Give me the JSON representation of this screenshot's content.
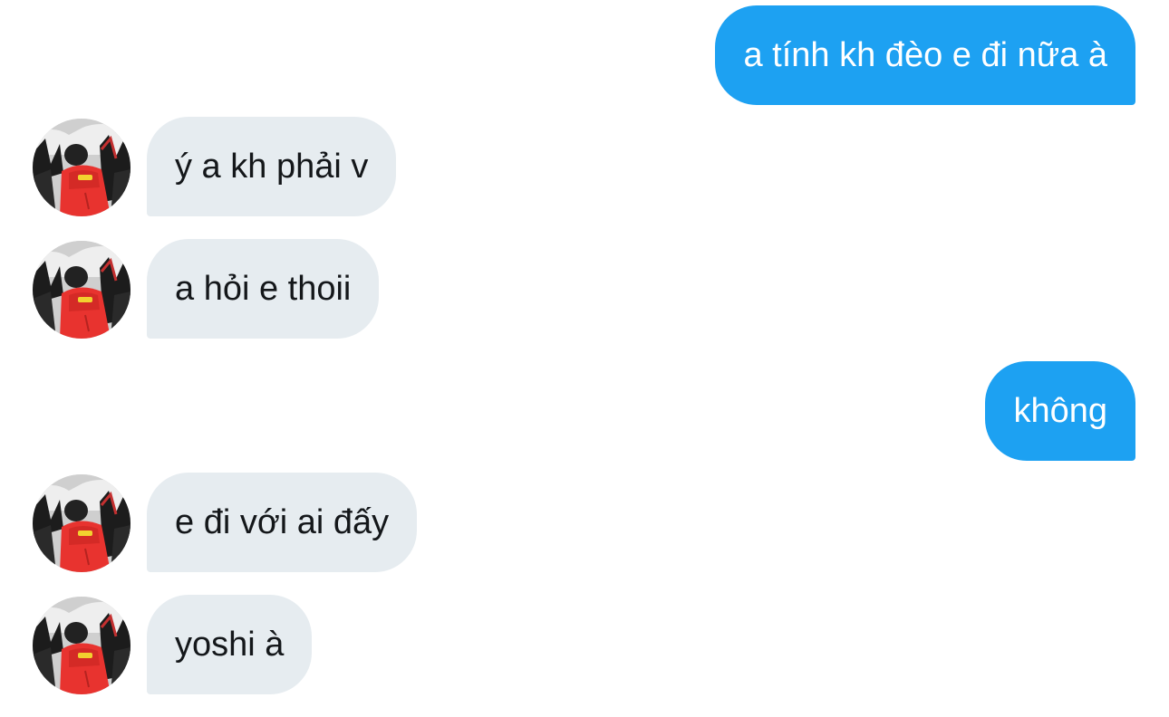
{
  "conversation": {
    "messages": [
      {
        "direction": "out",
        "text": "a tính kh đèo e đi nữa à"
      },
      {
        "direction": "in",
        "text": "ý a kh phải v",
        "avatar": "user-avatar"
      },
      {
        "direction": "in",
        "text": "a hỏi e thoii",
        "avatar": "user-avatar"
      },
      {
        "direction": "out",
        "text": "không"
      },
      {
        "direction": "in",
        "text": "e đi với ai đấy",
        "avatar": "user-avatar"
      },
      {
        "direction": "in",
        "text": "yoshi à",
        "avatar": "user-avatar"
      }
    ]
  },
  "colors": {
    "outgoing_bubble": "#1da1f2",
    "incoming_bubble": "#e6ecf0",
    "incoming_text": "#14171a",
    "avatar_red_jacket": "#e8332f"
  }
}
